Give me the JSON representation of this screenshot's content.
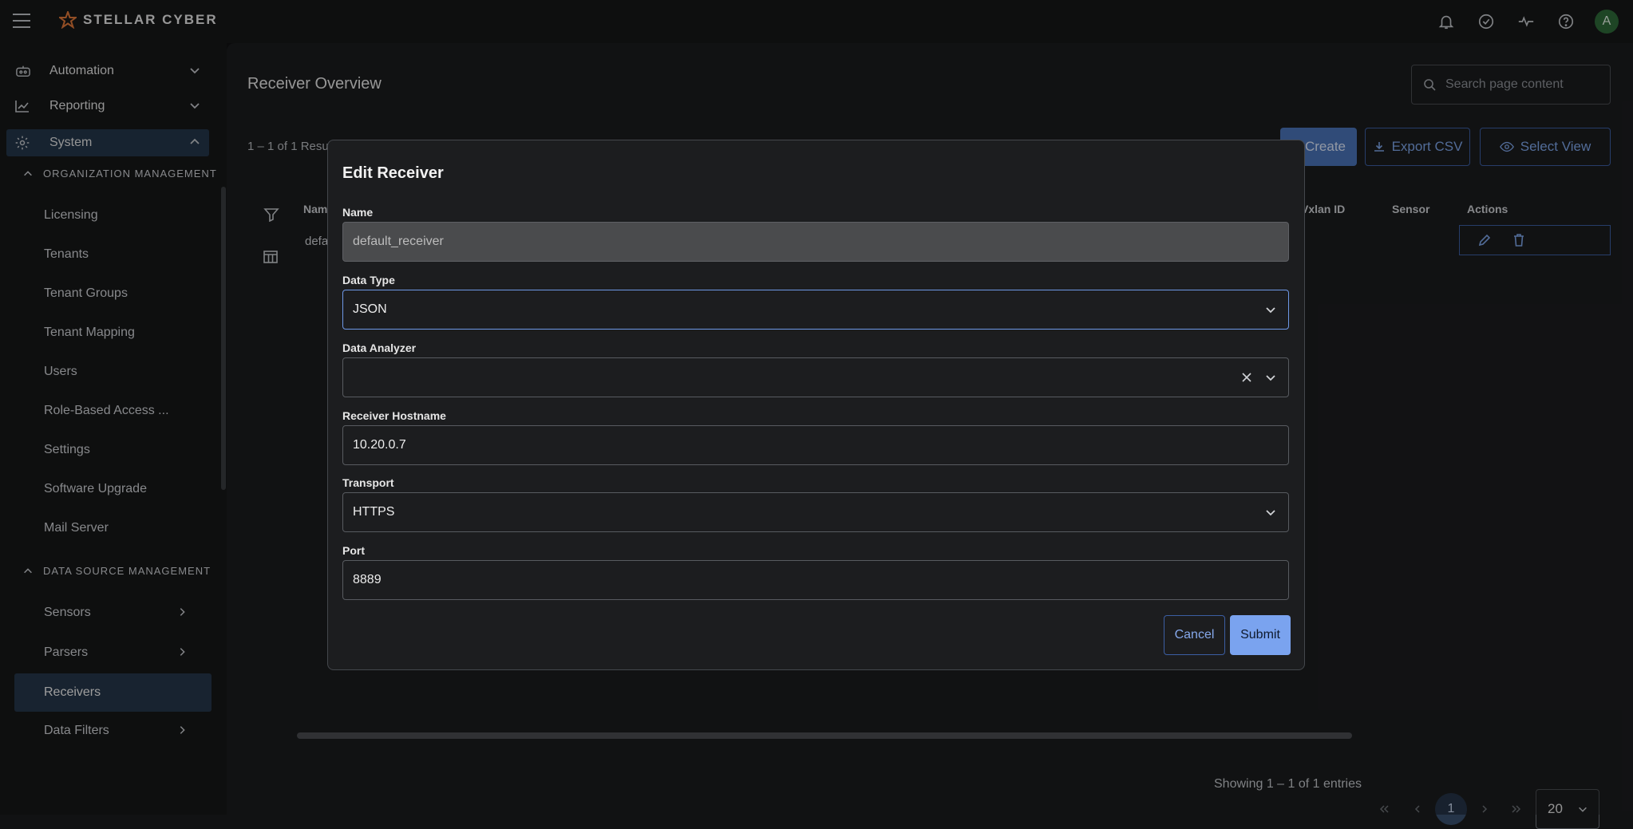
{
  "brand": {
    "name": "STELLAR CYBER"
  },
  "topbar": {
    "avatar_initial": "A",
    "icons": [
      "bell-icon",
      "check-circle-icon",
      "activity-icon",
      "help-icon"
    ]
  },
  "sidebar": {
    "top_items": [
      {
        "label": "Automation",
        "icon": "robot-icon"
      },
      {
        "label": "Reporting",
        "icon": "chart-icon"
      },
      {
        "label": "System",
        "icon": "gear-icon"
      }
    ],
    "org_section": "ORGANIZATION MANAGEMENT",
    "org_items": [
      "Licensing",
      "Tenants",
      "Tenant Groups",
      "Tenant Mapping",
      "Users",
      "Role-Based Access ...",
      "Settings",
      "Software Upgrade",
      "Mail Server"
    ],
    "ds_section": "DATA SOURCE MANAGEMENT",
    "ds_items": [
      "Sensors",
      "Parsers",
      "Receivers",
      "Data Filters"
    ]
  },
  "main": {
    "title": "Receiver Overview",
    "search_placeholder": "Search page content",
    "results": "1 – 1 of 1 Resul",
    "create_label": "Create",
    "export_label": "Export CSV",
    "select_view_label": "Select View",
    "columns": {
      "name": "Nam",
      "vxlan": "Vxlan ID",
      "sensor": "Sensor",
      "actions": "Actions"
    },
    "row": {
      "name": "defa"
    },
    "showing": "Showing 1 – 1 of 1 entries",
    "current_page": "1",
    "page_size": "20"
  },
  "modal": {
    "title": "Edit Receiver",
    "name_label": "Name",
    "name_value": "default_receiver",
    "data_type_label": "Data Type",
    "data_type_value": "JSON",
    "data_analyzer_label": "Data Analyzer",
    "data_analyzer_value": "",
    "hostname_label": "Receiver Hostname",
    "hostname_value": "10.20.0.7",
    "transport_label": "Transport",
    "transport_value": "HTTPS",
    "port_label": "Port",
    "port_value": "8889",
    "cancel_label": "Cancel",
    "submit_label": "Submit"
  },
  "colors": {
    "accent": "#7aa3ef",
    "active_nav": "#26374a",
    "avatar": "#2e6b3a"
  }
}
